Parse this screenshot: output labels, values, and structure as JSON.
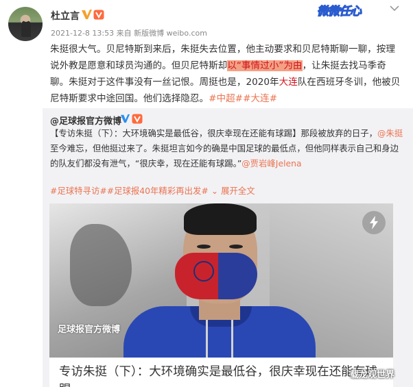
{
  "post": {
    "username": "杜立言",
    "meta": "2021-12-8 13:53 来自 新版微博 weibo.com",
    "banner_text": "微微任心",
    "text": {
      "p1": "朱挺很大气。贝尼特斯到来后，朱挺失去位置，他主动要求和贝尼特斯聊一聊，按理说外教是愿意和球员沟通的。但贝尼特斯却",
      "highlight": "以“事情过小”为由",
      "p2": "，让朱挺去找马季奇聊。朱挺对于这件事没有一丝记恨。周挺也是，2020年",
      "red_word": "大连",
      "p3": "队在西班牙冬训，他被贝尼特斯要求中途回国。他们选择隐忍。",
      "topic1": "#中超#",
      "topic2": "#大连#"
    }
  },
  "repost": {
    "username": "@足球报官方微博",
    "text_a": "【专访朱挺（下）：大环境确实是最低谷，很庆幸现在还能有球踢】那段被放弃的日子，",
    "mention1": "@朱挺",
    "text_b": " 至今难忘，但他挺过来了。朱挺坦言如今的确是中国足球的最低点，但他同样表示自己和身边的队友们都没有泄气，“很庆幸，现在还能有球踢。”",
    "mention2": "@贾岩峰Jelena",
    "topics": "#足球特寻访##足球报40年精彩再出发#",
    "expand": "展开全文",
    "photo_caption": "足球报官方微博",
    "card_title": "专访朱挺（下）：大环境确实是最低谷，很庆幸现在还能有球踢"
  },
  "watermark": "载龙观世界",
  "colors": {
    "highlight_bg": "#f4a084",
    "red": "#d0131b",
    "topic": "#eb7350",
    "repost_bg": "#f2f2f5",
    "verified": "#f7a02b"
  },
  "icons": {
    "verified": "verified-v-icon",
    "level": "level-badge-icon",
    "more": "chevron-down-icon",
    "bolt": "lightning-icon",
    "expand": "chevron-down-icon"
  }
}
